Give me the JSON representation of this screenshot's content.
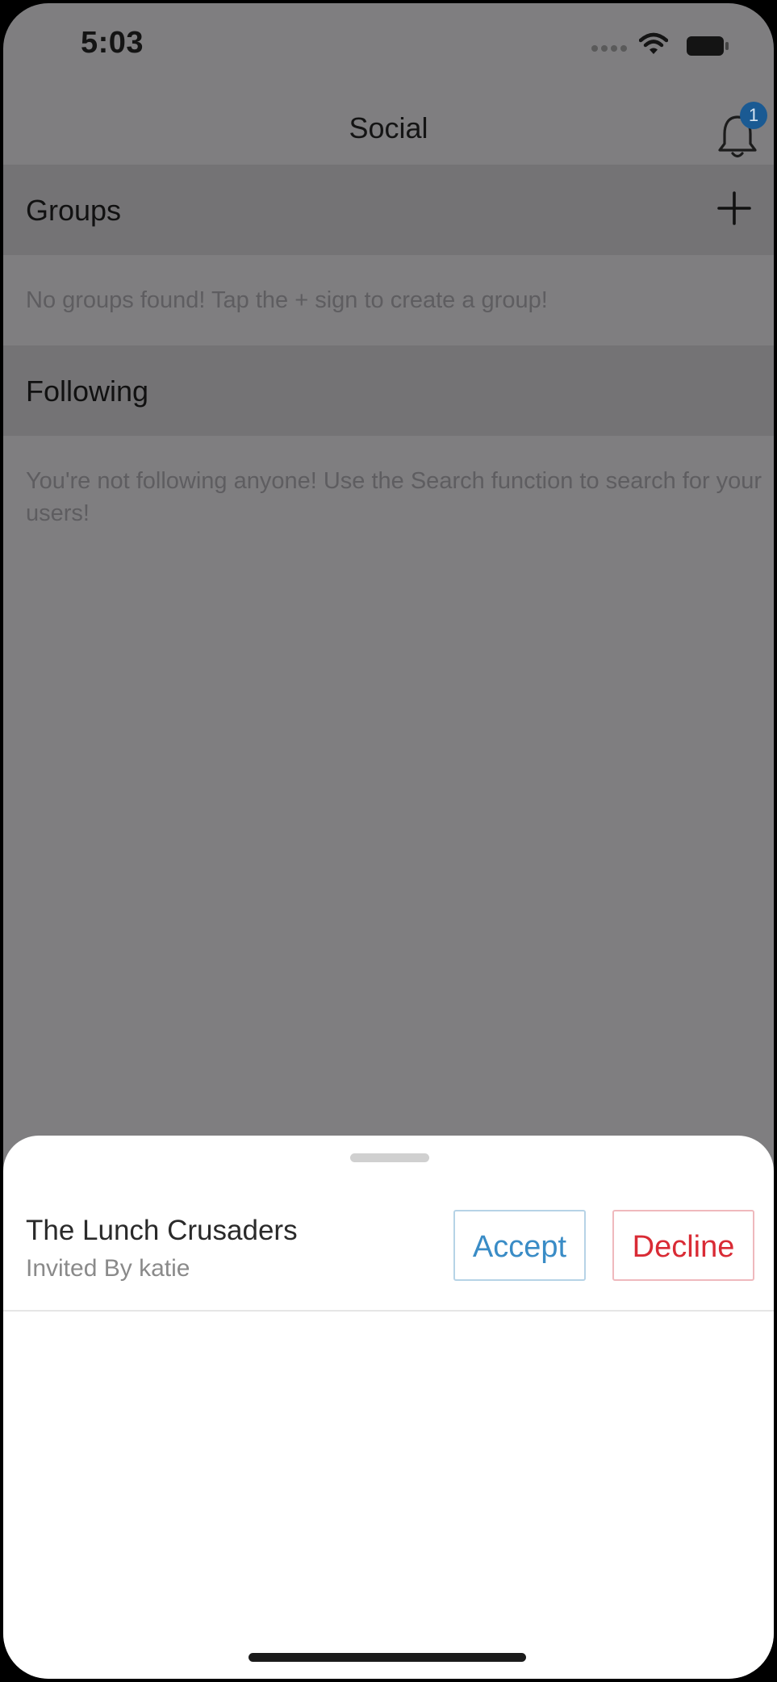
{
  "status_bar": {
    "time": "5:03",
    "icons": [
      "signal-dots-icon",
      "wifi-icon",
      "battery-icon"
    ]
  },
  "nav": {
    "title": "Social",
    "notifications_icon": "bell-icon",
    "notification_count": "1"
  },
  "groups": {
    "header": "Groups",
    "add_icon": "plus-icon",
    "empty_message": "No groups found! Tap the + sign to create a group!"
  },
  "following": {
    "header": "Following",
    "empty_message": "You're not following anyone! Use the Search function to search for your users!"
  },
  "invite_sheet": {
    "group_name": "The Lunch Crusaders",
    "invited_by": "Invited By katie",
    "accept_label": "Accept",
    "decline_label": "Decline"
  },
  "colors": {
    "overlay_gray": "#7f7e80",
    "section_header_gray": "#747375",
    "badge_blue": "#1a5a93",
    "accept_blue": "#3a8cc6",
    "decline_red": "#d92b35"
  }
}
